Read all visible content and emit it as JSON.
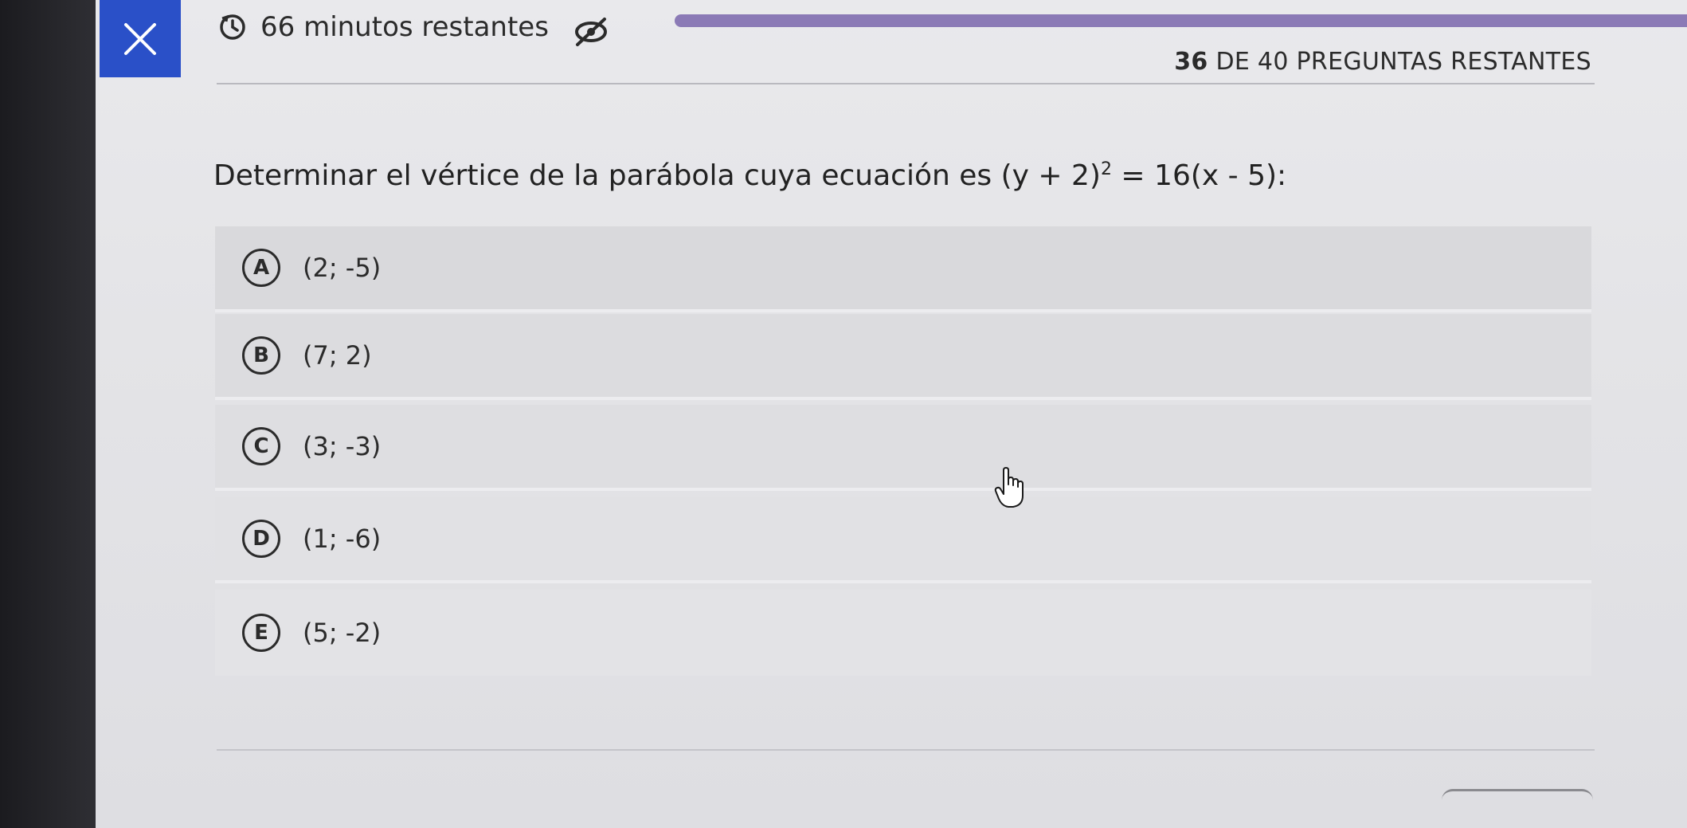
{
  "header": {
    "time_remaining": "66 minutos restantes",
    "questions_count": "36",
    "questions_suffix": "DE 40 PREGUNTAS RESTANTES",
    "progress_color": "#8b7ab6",
    "close_color": "#2a50c8"
  },
  "question": {
    "prefix": "Determinar el vértice de la parábola cuya ecuación es ",
    "eq_left": "(y + 2)",
    "exponent": "2",
    "eq_right": " = 16(x - 5):"
  },
  "options": [
    {
      "letter": "A",
      "text": "(2; -5)"
    },
    {
      "letter": "B",
      "text": "(7; 2)"
    },
    {
      "letter": "C",
      "text": "(3; -3)"
    },
    {
      "letter": "D",
      "text": "(1; -6)"
    },
    {
      "letter": "E",
      "text": "(5; -2)"
    }
  ],
  "icons": {
    "close": "close-icon",
    "timer": "timer-icon",
    "hide": "eye-off-icon",
    "cursor": "hand-cursor-icon"
  }
}
